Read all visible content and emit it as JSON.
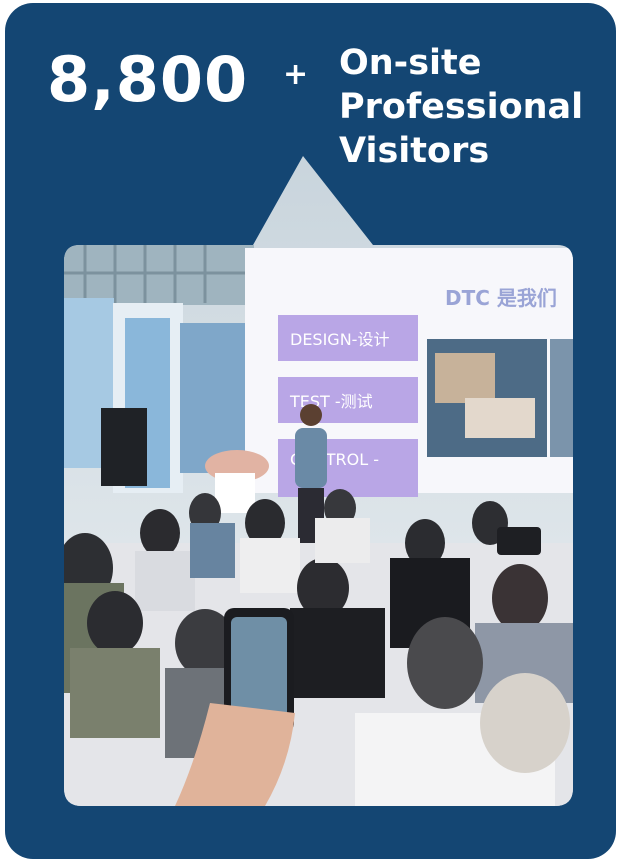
{
  "stat": {
    "number": "8,800",
    "suffix": "+",
    "label_line1": "On-site",
    "label_line2": "Professional",
    "label_line3": "Visitors"
  },
  "photo": {
    "screen_title": "DTC 是我们",
    "screen_items": [
      "DESIGN-设计",
      "TEST -测试",
      "CONTROL -"
    ]
  },
  "colors": {
    "card_background": "#144673",
    "text": "#ffffff",
    "slide_label": "#b9a6e6"
  }
}
